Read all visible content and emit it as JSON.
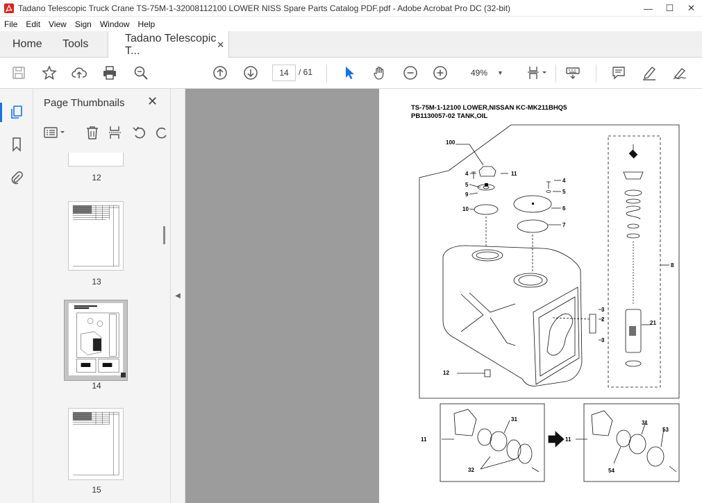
{
  "window": {
    "title": "Tadano Telescopic Truck Crane TS-75M-1-32008112100 LOWER NISS Spare Parts Catalog PDF.pdf - Adobe Acrobat Pro DC (32-bit)",
    "minimize": "—",
    "maximize": "☐",
    "close": "✕"
  },
  "menu": [
    "File",
    "Edit",
    "View",
    "Sign",
    "Window",
    "Help"
  ],
  "tabs": {
    "home": "Home",
    "tools": "Tools",
    "document": "Tadano Telescopic T...",
    "close": "✕"
  },
  "toolbar": {
    "current_page": "14",
    "page_separator": "/ 61",
    "zoom": "49%"
  },
  "panel": {
    "title": "Page Thumbnails",
    "close": "✕",
    "thumbnails": [
      {
        "label": "12"
      },
      {
        "label": "13"
      },
      {
        "label": "14",
        "selected": true
      },
      {
        "label": "15"
      }
    ]
  },
  "document": {
    "title_line1": "TS-75M-1-12100 LOWER,NISSAN KC-MK211BHQ5",
    "title_line2": "PB1130057-02 TANK,OIL",
    "callouts": {
      "c100": "100",
      "c4a": "4",
      "c11a": "11",
      "c5a": "5",
      "c9": "9",
      "c10": "10",
      "c4b": "4",
      "c5b": "5",
      "c6": "6",
      "c7": "7",
      "c8": "8",
      "c3a": "3",
      "c2": "2",
      "c3b": "3",
      "c21": "21",
      "c12": "12",
      "c11b": "11",
      "c31a": "31",
      "c32": "32",
      "c11c": "11",
      "c31b": "31",
      "c53": "53",
      "c54": "54"
    }
  },
  "colors": {
    "accent": "#1473e6",
    "viewer_bg": "#9c9c9c",
    "acrobat_red": "#d7261e"
  }
}
